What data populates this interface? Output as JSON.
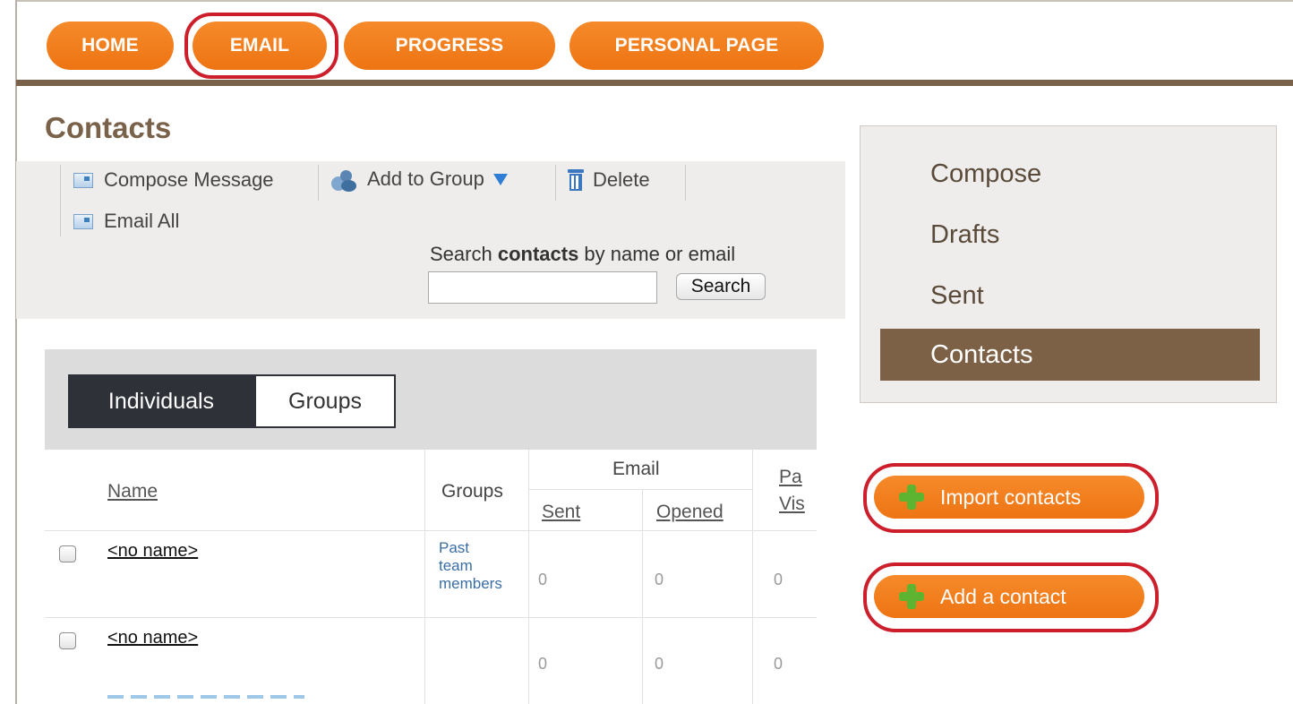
{
  "nav": {
    "home": "HOME",
    "email": "EMAIL",
    "progress": "PROGRESS",
    "personal": "PERSONAL PAGE"
  },
  "page": {
    "title": "Contacts"
  },
  "toolbar": {
    "compose": "Compose Message",
    "add_to_group": "Add to Group",
    "delete": "Delete",
    "email_all": "Email All"
  },
  "search": {
    "label_prefix": "Search ",
    "label_bold": "contacts",
    "label_suffix": " by name or email",
    "value": "",
    "button": "Search"
  },
  "tabs": {
    "individuals": "Individuals",
    "groups": "Groups"
  },
  "table": {
    "headers": {
      "name": "Name",
      "groups": "Groups",
      "email": "Email",
      "sent": "Sent",
      "opened": "Opened",
      "page_visits_top": "Pa",
      "page_visits_bottom": "Vis"
    },
    "rows": [
      {
        "name": "<no name>",
        "groups": [
          "Past",
          "team",
          "members"
        ],
        "sent": "0",
        "opened": "0",
        "visits": "0"
      },
      {
        "name": "<no name>",
        "groups": [],
        "sent": "0",
        "opened": "0",
        "visits": "0"
      }
    ]
  },
  "sidebar": {
    "items": [
      {
        "label": "Compose"
      },
      {
        "label": "Drafts"
      },
      {
        "label": "Sent"
      },
      {
        "label": "Contacts"
      }
    ]
  },
  "actions": {
    "import": "Import contacts",
    "add": "Add a contact"
  },
  "colors": {
    "accent_orange": "#f07d1c",
    "brown": "#7a6149",
    "highlight_red": "#cc1f2b",
    "plus_green": "#5cb431"
  }
}
